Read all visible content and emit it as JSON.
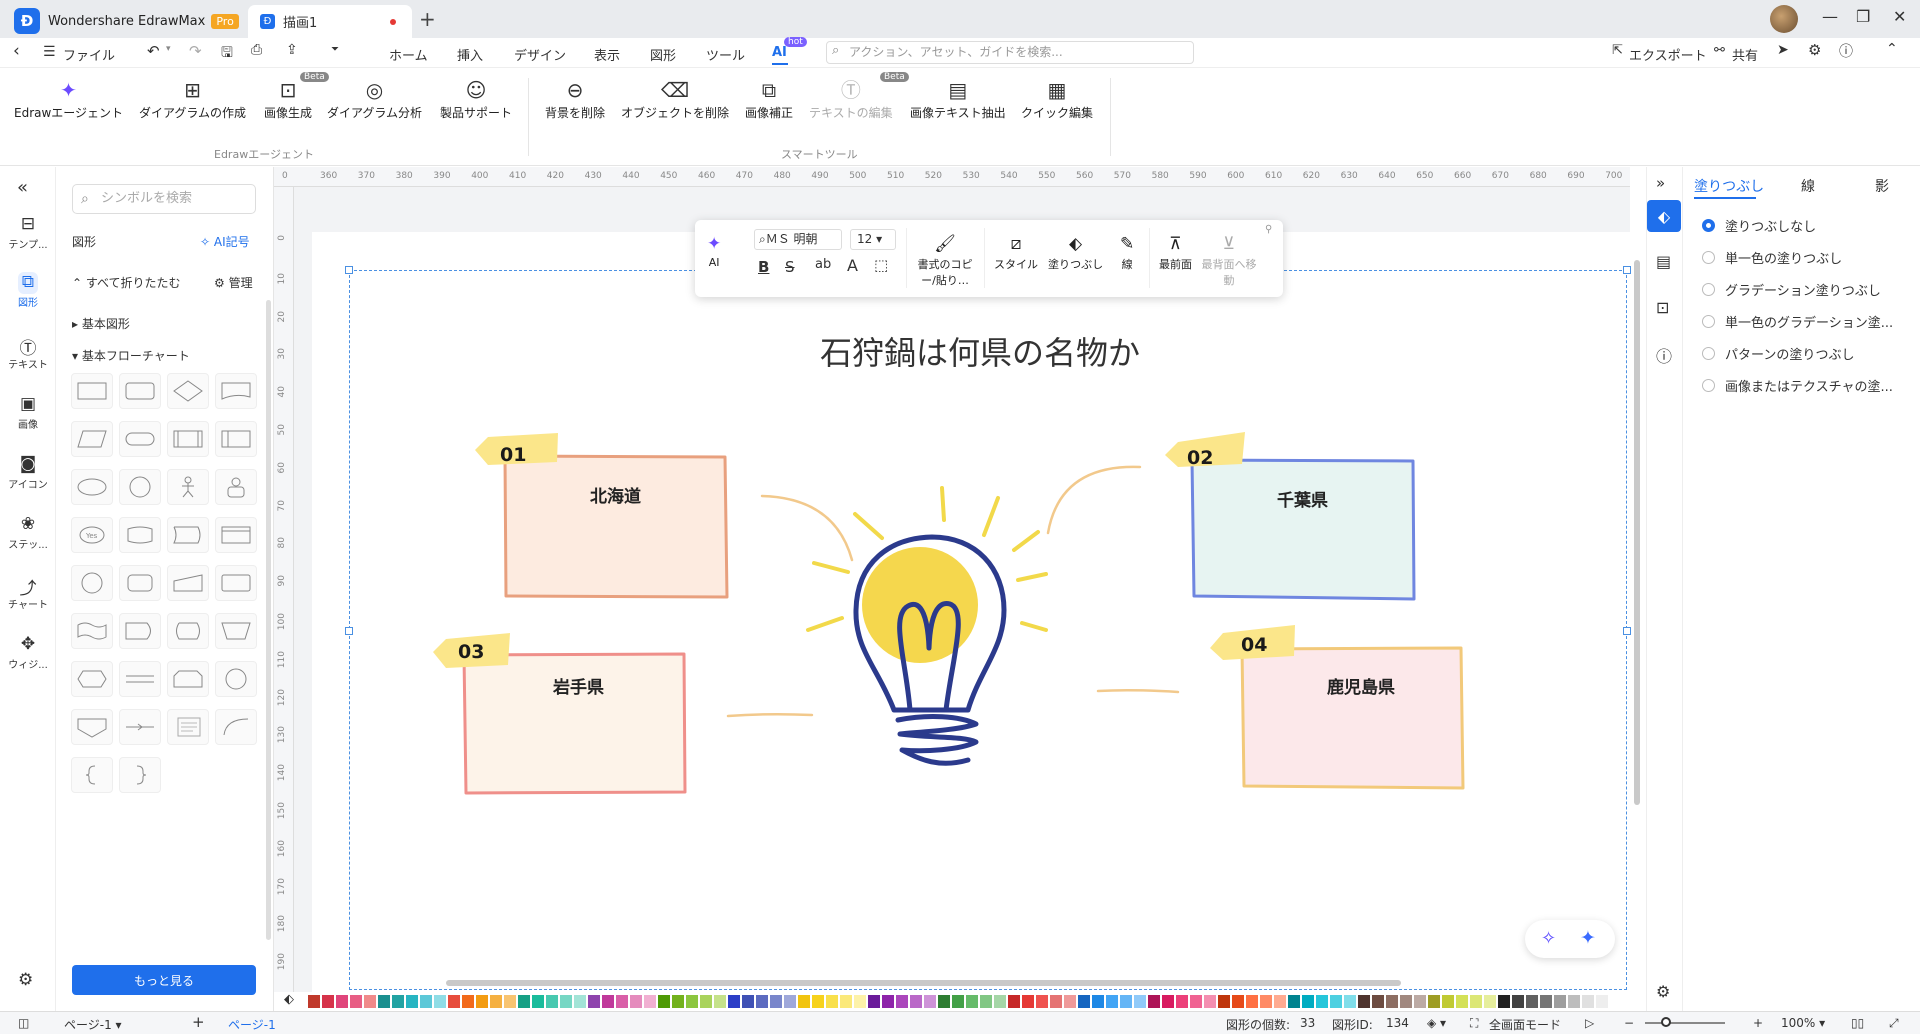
{
  "titlebar": {
    "app_name": "Wondershare EdrawMax",
    "pro_badge": "Pro",
    "doc_tab": "描画1"
  },
  "menu": {
    "back": "‹",
    "file": "ファイル",
    "tabs": [
      "ホーム",
      "挿入",
      "デザイン",
      "表示",
      "図形",
      "ツール",
      "AI"
    ],
    "hot_badge": "hot",
    "search_placeholder": "アクション、アセット、ガイドを検索...",
    "export": "エクスポート",
    "share": "共有"
  },
  "ribbon": {
    "agent_group": [
      {
        "label": "Edrawエージェント",
        "icon": "sparkle-icon"
      },
      {
        "label": "ダイアグラムの作成",
        "icon": "diagram-icon"
      },
      {
        "label": "画像生成",
        "icon": "image-gen-icon",
        "badge": "Beta"
      },
      {
        "label": "ダイアグラム分析",
        "icon": "analysis-icon"
      },
      {
        "label": "製品サポート",
        "icon": "support-icon"
      }
    ],
    "smart_group": [
      {
        "label": "背景を削除",
        "icon": "remove-bg-icon"
      },
      {
        "label": "オブジェクトを削除",
        "icon": "eraser-icon"
      },
      {
        "label": "画像補正",
        "icon": "enhance-icon"
      },
      {
        "label": "テキストの編集",
        "icon": "text-edit-icon",
        "badge": "Beta",
        "disabled": true
      },
      {
        "label": "画像テキスト抽出",
        "icon": "ocr-icon"
      },
      {
        "label": "クイック編集",
        "icon": "quick-edit-icon"
      }
    ],
    "group_labels": [
      "Edrawエージェント",
      "スマートツール"
    ]
  },
  "left_rail": [
    "テンプ...",
    "図形",
    "テキスト",
    "画像",
    "アイコン",
    "ステッ...",
    "チャート",
    "ウィジ..."
  ],
  "symbols": {
    "search_placeholder": "シンボルを検索",
    "header": "図形",
    "ai_symbol": "AI記号",
    "collapse_all": "すべて折りたたむ",
    "manage": "管理",
    "cat_basic": "基本図形",
    "cat_flowchart": "基本フローチャート",
    "more_button": "もっと見る"
  },
  "ruler": {
    "h_ticks": [
      "0",
      "360",
      "370",
      "380",
      "390",
      "400",
      "410",
      "420",
      "430",
      "440",
      "450",
      "460",
      "470",
      "480",
      "490",
      "500",
      "510",
      "520",
      "530",
      "540",
      "550",
      "560",
      "570",
      "580",
      "590",
      "600",
      "610",
      "620",
      "630",
      "640",
      "650",
      "660",
      "670",
      "680",
      "690",
      "700"
    ],
    "v_ticks": [
      "0",
      "10",
      "20",
      "30",
      "40",
      "50",
      "60",
      "70",
      "80",
      "90",
      "100",
      "110",
      "120",
      "130",
      "140",
      "150",
      "160",
      "170",
      "180",
      "190"
    ]
  },
  "float_toolbar": {
    "ai": "AI",
    "font": "ＭＳ 明朝",
    "font_size": "12",
    "format_painter": "書式のコピー/貼り…",
    "style": "スタイル",
    "fill": "塗りつぶし",
    "line": "線",
    "bring_front": "最前面",
    "send_back": "最背面へ移動"
  },
  "diagram": {
    "title": "石狩鍋は何県の名物か",
    "cards": [
      {
        "num": "01",
        "label": "北海道",
        "fill": "#fdebe0",
        "stroke": "#e8a07e"
      },
      {
        "num": "02",
        "label": "千葉県",
        "fill": "#e7f4f2",
        "stroke": "#6f86e0"
      },
      {
        "num": "03",
        "label": "岩手県",
        "fill": "#fdf3e9",
        "stroke": "#ef8f8a"
      },
      {
        "num": "04",
        "label": "鹿児島県",
        "fill": "#fce8ea",
        "stroke": "#f2c97a"
      }
    ]
  },
  "right_panel": {
    "tabs": [
      "塗りつぶし",
      "線",
      "影"
    ],
    "options": [
      "塗りつぶしなし",
      "単一色の塗りつぶし",
      "グラデーション塗りつぶし",
      "単一色のグラデーション塗...",
      "パターンの塗りつぶし",
      "画像またはテクスチャの塗..."
    ],
    "selected_index": 0
  },
  "status": {
    "page_select": "ページ-1",
    "page_tab": "ページ-1",
    "shape_count_label": "図形の個数:",
    "shape_count": "33",
    "shape_id_label": "図形ID:",
    "shape_id": "134",
    "fullscreen": "全画面モード",
    "zoom": "100%"
  },
  "palette": [
    "#c0392b",
    "#d6334a",
    "#e0457b",
    "#e85d84",
    "#f08a8a",
    "#1a8f8f",
    "#22a3a3",
    "#27b5c2",
    "#5cc8d8",
    "#8fdde6",
    "#e74c3c",
    "#f26a1b",
    "#f39c12",
    "#f5b041",
    "#f8c471",
    "#16a085",
    "#1abc9c",
    "#48c9b0",
    "#76d7c4",
    "#a3e4d7",
    "#8e44ad",
    "#c0399b",
    "#d95fa8",
    "#e58bbd",
    "#f1b0d2",
    "#4e9a06",
    "#73b21d",
    "#8cc63f",
    "#a9d35c",
    "#c5e28a",
    "#2c3ec7",
    "#3f51b5",
    "#5c6bc0",
    "#7986cb",
    "#9fa8da",
    "#f1c40f",
    "#f7d21c",
    "#f9e04b",
    "#fbe97a",
    "#fdf2a9",
    "#6a1b9a",
    "#8e24aa",
    "#ab47bc",
    "#ba68c8",
    "#ce93d8",
    "#2e7d32",
    "#43a047",
    "#66bb6a",
    "#81c784",
    "#a5d6a7",
    "#c62828",
    "#e53935",
    "#ef5350",
    "#e57373",
    "#ef9a9a",
    "#1565c0",
    "#1e88e5",
    "#42a5f5",
    "#64b5f6",
    "#90caf9",
    "#ad1457",
    "#d81b60",
    "#ec407a",
    "#f06292",
    "#f48fb1",
    "#bf360c",
    "#e64a19",
    "#ff7043",
    "#ff8a65",
    "#ffab91",
    "#00838f",
    "#00acc1",
    "#26c6da",
    "#4dd0e1",
    "#80deea",
    "#4e342e",
    "#6d4c41",
    "#8d6e63",
    "#a1887f",
    "#bcaaa4",
    "#9e9d24",
    "#c0ca33",
    "#d4e157",
    "#dce775",
    "#e6ee9c",
    "#212121",
    "#424242",
    "#616161",
    "#757575",
    "#9e9e9e",
    "#bdbdbd",
    "#e0e0e0",
    "#eeeeee"
  ]
}
